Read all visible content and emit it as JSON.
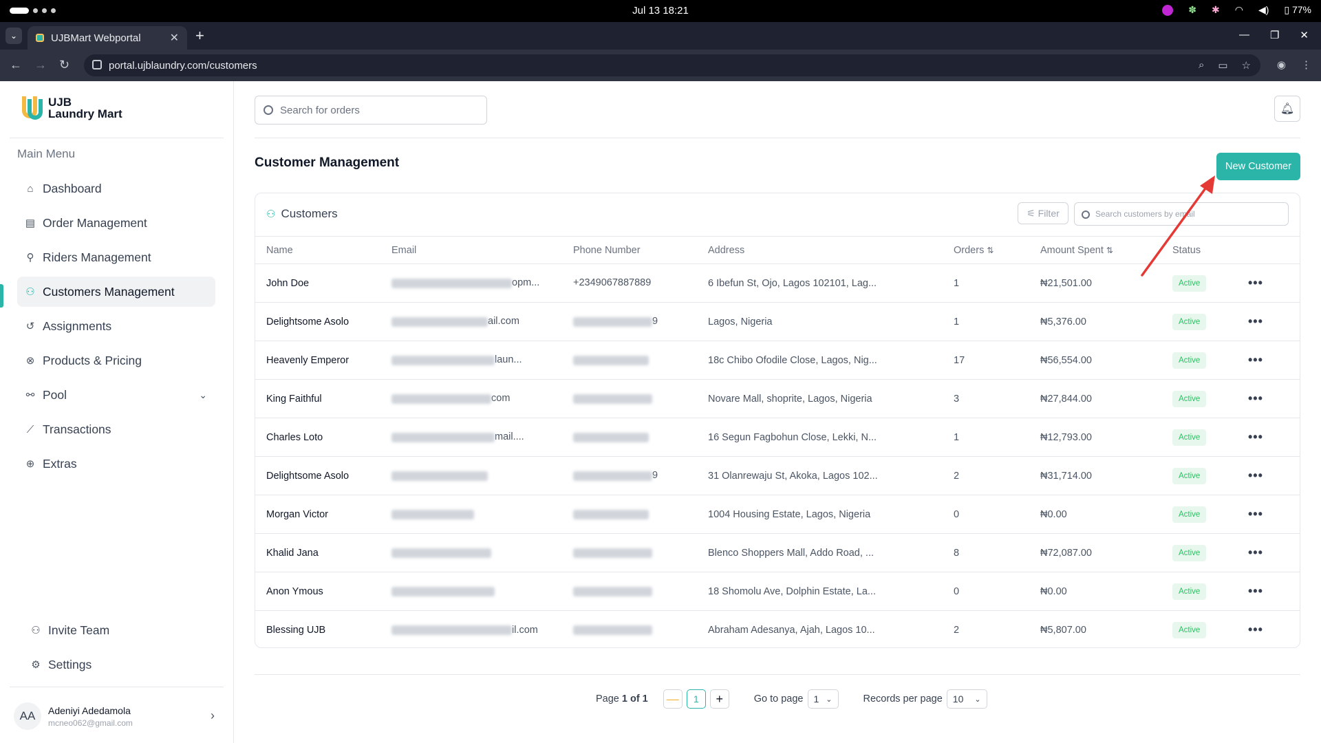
{
  "os": {
    "datetime": "Jul 13  18:21",
    "battery": "77%"
  },
  "browser": {
    "tab_title": "UJBMart Webportal",
    "url": "portal.ujblaundry.com/customers"
  },
  "sidebar": {
    "logo_line1": "UJB",
    "logo_line2": "Laundry Mart",
    "menu_title": "Main Menu",
    "items": [
      {
        "label": "Dashboard",
        "icon": "home-icon"
      },
      {
        "label": "Order Management",
        "icon": "clipboard-icon"
      },
      {
        "label": "Riders Management",
        "icon": "bike-icon"
      },
      {
        "label": "Customers Management",
        "icon": "users-icon",
        "active": true
      },
      {
        "label": "Assignments",
        "icon": "history-icon"
      },
      {
        "label": "Products & Pricing",
        "icon": "tag-icon"
      },
      {
        "label": "Pool",
        "icon": "pool-icon"
      },
      {
        "label": "Transactions",
        "icon": "chart-line-icon"
      },
      {
        "label": "Extras",
        "icon": "globe-icon"
      }
    ],
    "bottom_items": [
      {
        "label": "Invite Team",
        "icon": "user-plus-icon"
      },
      {
        "label": "Settings",
        "icon": "gear-icon"
      }
    ],
    "user": {
      "initials": "AA",
      "name": "Adeniyi Adedamola",
      "email": "mcneo062@gmail.com"
    }
  },
  "header": {
    "search_placeholder": "Search for orders"
  },
  "page": {
    "title": "Customer Management",
    "new_button": "New Customer"
  },
  "table_card": {
    "title": "Customers",
    "filter_label": "Filter",
    "search_placeholder": "Search customers by email",
    "columns": [
      "Name",
      "Email",
      "Phone Number",
      "Address",
      "Orders",
      "Amount Spent",
      "Status"
    ],
    "rows": [
      {
        "name": "John Doe",
        "email_visible": "opm...",
        "phone_visible": "+2349067887889",
        "address": "6 Ibefun St, Ojo, Lagos 102101, Lag...",
        "orders": "1",
        "amount": "₦21,501.00",
        "status": "Active"
      },
      {
        "name": "Delightsome Asolo",
        "email_visible": "ail.com",
        "phone_visible": "9",
        "address": "Lagos, Nigeria",
        "orders": "1",
        "amount": "₦5,376.00",
        "status": "Active"
      },
      {
        "name": "Heavenly Emperor",
        "email_visible": "laun...",
        "phone_visible": "",
        "address": "18c Chibo Ofodile Close, Lagos, Nig...",
        "orders": "17",
        "amount": "₦56,554.00",
        "status": "Active"
      },
      {
        "name": "King Faithful",
        "email_visible": "com",
        "phone_visible": "",
        "address": "Novare Mall, shoprite, Lagos, Nigeria",
        "orders": "3",
        "amount": "₦27,844.00",
        "status": "Active"
      },
      {
        "name": "Charles Loto",
        "email_visible": "mail....",
        "phone_visible": "",
        "address": "16 Segun Fagbohun Close, Lekki, N...",
        "orders": "1",
        "amount": "₦12,793.00",
        "status": "Active"
      },
      {
        "name": "Delightsome Asolo",
        "email_visible": "",
        "phone_visible": "9",
        "address": "31 Olanrewaju St, Akoka, Lagos 102...",
        "orders": "2",
        "amount": "₦31,714.00",
        "status": "Active"
      },
      {
        "name": "Morgan Victor",
        "email_visible": "",
        "phone_visible": "",
        "address": "1004 Housing Estate, Lagos, Nigeria",
        "orders": "0",
        "amount": "₦0.00",
        "status": "Active"
      },
      {
        "name": "Khalid Jana",
        "email_visible": "",
        "phone_visible": "",
        "address": "Blenco Shoppers Mall, Addo Road, ...",
        "orders": "8",
        "amount": "₦72,087.00",
        "status": "Active"
      },
      {
        "name": "Anon Ymous",
        "email_visible": "",
        "phone_visible": "",
        "address": "18 Shomolu Ave, Dolphin Estate, La...",
        "orders": "0",
        "amount": "₦0.00",
        "status": "Active"
      },
      {
        "name": "Blessing UJB",
        "email_visible": "il.com",
        "phone_visible": "",
        "address": "Abraham Adesanya, Ajah, Lagos 10...",
        "orders": "2",
        "amount": "₦5,807.00",
        "status": "Active"
      }
    ]
  },
  "pagination": {
    "page_label_prefix": "Page ",
    "page_label_current": "1 of 1",
    "current_page": "1",
    "goto_label": "Go to page",
    "goto_value": "1",
    "per_page_label": "Records per page",
    "per_page_value": "10"
  },
  "colors": {
    "accent": "#2bb5a9",
    "accent_yellow": "#f4b942",
    "badge_bg": "#e8f7ee",
    "badge_text": "#22c55e",
    "arrow": "#e53935"
  }
}
